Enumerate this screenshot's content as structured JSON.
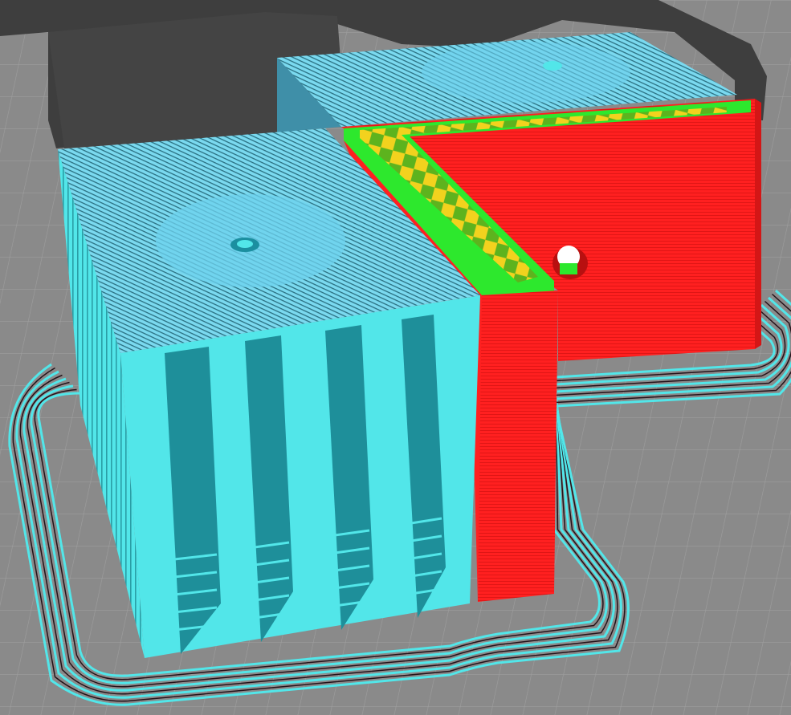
{
  "viewport": {
    "name": "slicer-layer-preview",
    "colors": {
      "bed": "#8a8a8a",
      "bed_grid": "#9d9d9d",
      "shadow": "#3d3d3d",
      "support": "#52e6e9",
      "support_top": "#7ad9ef",
      "support_line": "#1a7f86",
      "outer_wall": "#ff2020",
      "outer_wall_line": "#b01010",
      "inner_wall": "#2de82d",
      "infill": "#f2d21e",
      "brim_line": "#23131a"
    },
    "brim_loops": 9
  }
}
